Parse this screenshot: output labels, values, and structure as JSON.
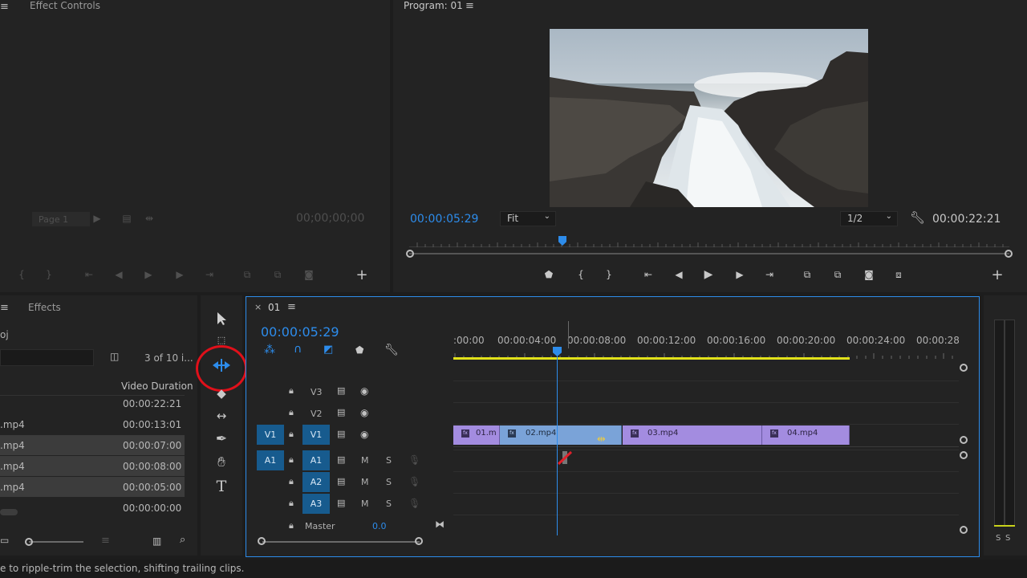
{
  "effect_controls": {
    "title": "Effect Controls",
    "page_label": "Page 1",
    "timecode": "00;00;00;00"
  },
  "program": {
    "title": "Program: 01",
    "timecode": "00:00:05:29",
    "fit": "Fit",
    "resolution": "1/2",
    "duration": "00:00:22:21"
  },
  "project": {
    "tab_effects": "Effects",
    "proj_label": "oj",
    "item_count": "3 of 10 i...",
    "col_duration": "Video Duration",
    "items": [
      {
        "name": "",
        "duration": "00:00:22:21",
        "selected": false
      },
      {
        "name": ".mp4",
        "duration": "00:00:13:01",
        "selected": false
      },
      {
        "name": ".mp4",
        "duration": "00:00:07:00",
        "selected": true
      },
      {
        "name": ".mp4",
        "duration": "00:00:08:00",
        "selected": true
      },
      {
        "name": ".mp4",
        "duration": "00:00:05:00",
        "selected": true
      },
      {
        "name": "",
        "duration": "00:00:00:00",
        "selected": false
      }
    ]
  },
  "timeline": {
    "tab": "01",
    "timecode": "00:00:05:29",
    "ruler_labels": [
      ":00:00",
      "00:00:04:00",
      "00:00:08:00",
      "00:00:12:00",
      "00:00:16:00",
      "00:00:20:00",
      "00:00:24:00",
      "00:00:28:"
    ],
    "tracks": {
      "v3": "V3",
      "v2": "V2",
      "v1": "V1",
      "v1_src": "V1",
      "a1": "A1",
      "a1_src": "A1",
      "a2": "A2",
      "a3": "A3",
      "m": "M",
      "s": "S",
      "master": "Master",
      "master_val": "0.0"
    },
    "clips": [
      "01.m",
      "02.mp4",
      "03.mp4",
      "04.mp4"
    ],
    "fx": "fx"
  },
  "meter": {
    "s1": "S",
    "s2": "S"
  },
  "status": "e to ripple-trim the selection, shifting trailing clips.",
  "colors": {
    "accent": "#2d8ceb",
    "clip": "#a38ce0",
    "highlight_circle": "#e0101a",
    "workarea": "#e2e21a"
  }
}
